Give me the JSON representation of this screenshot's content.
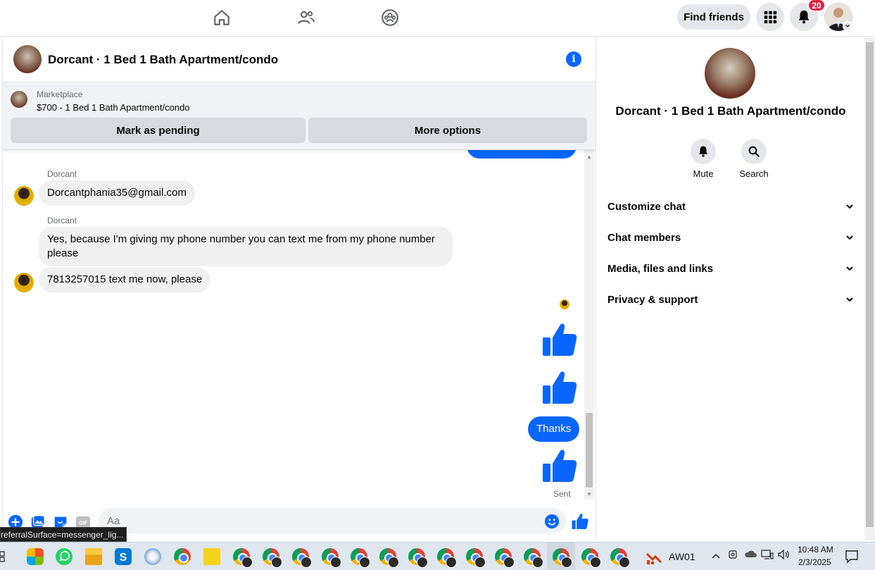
{
  "topnav": {
    "find_friends_label": "Find friends",
    "notification_count": "20"
  },
  "chat": {
    "title": "Dorcant · 1 Bed 1 Bath Apartment/condo",
    "marketplace": {
      "label": "Marketplace",
      "listing": "$700 - 1 Bed 1 Bath Apartment/condo",
      "pending_button": "Mark as pending",
      "options_button": "More options"
    },
    "messages": [
      {
        "sender": "Dorcant",
        "text": "Dorcantphania35@gmail.com"
      },
      {
        "sender": "Dorcant",
        "text": "Yes, because I'm giving my phone number you can text me from my phone number please"
      },
      {
        "sender": "",
        "text": "7813257015 text me now, please"
      },
      {
        "sender": "me",
        "text": "Thanks"
      }
    ],
    "sent_label": "Sent",
    "composer_placeholder": "Aa"
  },
  "right_panel": {
    "title": "Dorcant · 1 Bed 1 Bath Apartment/condo",
    "actions": [
      {
        "label": "Mute",
        "icon": "bell-icon"
      },
      {
        "label": "Search",
        "icon": "search-icon"
      }
    ],
    "sections": [
      "Customize chat",
      "Chat members",
      "Media, files and links",
      "Privacy & support"
    ]
  },
  "status_tip": "referralSurface=messenger_lig...",
  "taskbar": {
    "tray_label": "AW01",
    "time": "10:48 AM",
    "date": "2/3/2025"
  },
  "colors": {
    "accent": "#0866ff",
    "badge": "#e41e3f",
    "bubble_in": "#f0f0f0"
  }
}
